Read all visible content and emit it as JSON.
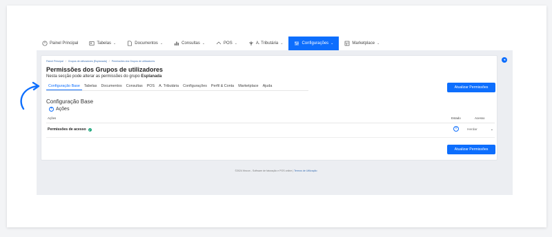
{
  "nav": {
    "items": [
      {
        "label": "Painel Principal",
        "icon": "dashboard-icon",
        "chevron": ""
      },
      {
        "label": "Tabelas",
        "icon": "user-card-icon",
        "chevron": "⌄"
      },
      {
        "label": "Documentos",
        "icon": "document-icon",
        "chevron": "⌄"
      },
      {
        "label": "Consultas",
        "icon": "bar-chart-icon",
        "chevron": "⌄"
      },
      {
        "label": "POS",
        "icon": "pos-icon",
        "chevron": "⌄"
      },
      {
        "label": "A. Tributária",
        "icon": "tax-icon",
        "chevron": "⌄"
      },
      {
        "label": "Configurações",
        "icon": "settings-sliders-icon",
        "chevron": "⌄"
      },
      {
        "label": "Marketplace",
        "icon": "marketplace-icon",
        "chevron": "⌄"
      }
    ],
    "active_index": 6
  },
  "breadcrumb": [
    "Painel Principal",
    "Grupos de utilizadores [Esplanada]",
    "Permissões dos Grupos de utilizadores"
  ],
  "page": {
    "title": "Permissões dos Grupos de utilizadores",
    "subtitle_prefix": "Nesta secção pode alterar as permissões do grupo",
    "subtitle_group": "Esplanada"
  },
  "tabs": [
    "Configuração Base",
    "Tabelas",
    "Documentos",
    "Consultas",
    "POS",
    "A. Tributária",
    "Configurações",
    "Perfil & Conta",
    "Marketplace",
    "Ajuda"
  ],
  "active_tab": 0,
  "buttons": {
    "update_top": "Atualizar Permissões",
    "update_bottom": "Atualizar Permissões"
  },
  "section": {
    "title": "Configuração Base",
    "add_actions": "Ações"
  },
  "table": {
    "headers": {
      "acoes": "Ações",
      "estado": "Estado",
      "acesso": "Acesso"
    },
    "rows": [
      {
        "label": "Permissões de acesso",
        "access": "Herdar"
      }
    ]
  },
  "footer": {
    "text": "©2024 Itincon - Software de faturação e POS online |",
    "terms": "Termos de Utilização"
  },
  "colors": {
    "accent": "#0d6efd",
    "success": "#1aa67a"
  }
}
